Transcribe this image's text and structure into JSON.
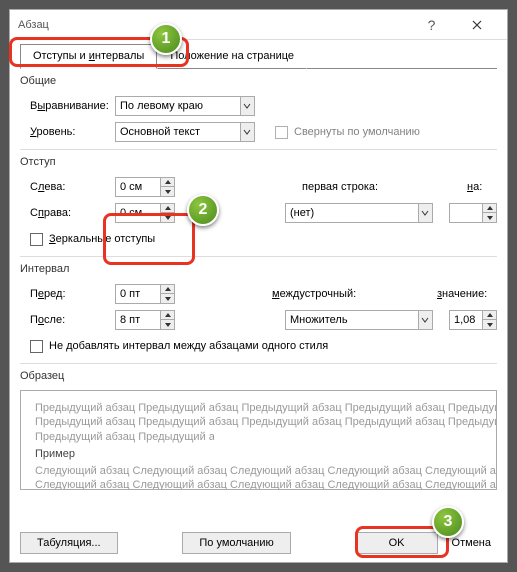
{
  "title": "Абзац",
  "tabs": {
    "indents": "Отступы и интервалы",
    "position": "Положение на странице"
  },
  "general": {
    "heading": "Общие",
    "alignment_label": "Выравнивание:",
    "alignment_value": "По левому краю",
    "level_label": "Уровень:",
    "level_value": "Основной текст",
    "collapsed": "Свернуты по умолчанию"
  },
  "indent": {
    "heading": "Отступ",
    "left_label": "Слева:",
    "left_value": "0 см",
    "right_label": "Справа:",
    "right_value": "0 см",
    "first_label": "первая строка:",
    "first_value": "(нет)",
    "on_label": "на:",
    "mirror": "Зеркальные отступы"
  },
  "spacing": {
    "heading": "Интервал",
    "before_label": "Перед:",
    "before_value": "0 пт",
    "after_label": "После:",
    "after_value": "8 пт",
    "line_label": "междустрочный:",
    "line_value": "Множитель",
    "value_label": "значение:",
    "value_value": "1,08",
    "dont_add": "Не добавлять интервал между абзацами одного стиля"
  },
  "sample": {
    "heading": "Образец",
    "prev": "Предыдущий абзац Предыдущий абзац Предыдущий абзац Предыдущий абзац Предыдущий абзац",
    "example": "Пример",
    "next": "Следующий абзац Следующий абзац Следующий абзац Следующий абзац Следующий абзац Следующий абз"
  },
  "footer": {
    "tabs": "Табуляция...",
    "default": "По умолчанию",
    "ok": "OK",
    "cancel": "Отмена"
  },
  "callouts": {
    "c1": "1",
    "c2": "2",
    "c3": "3"
  }
}
